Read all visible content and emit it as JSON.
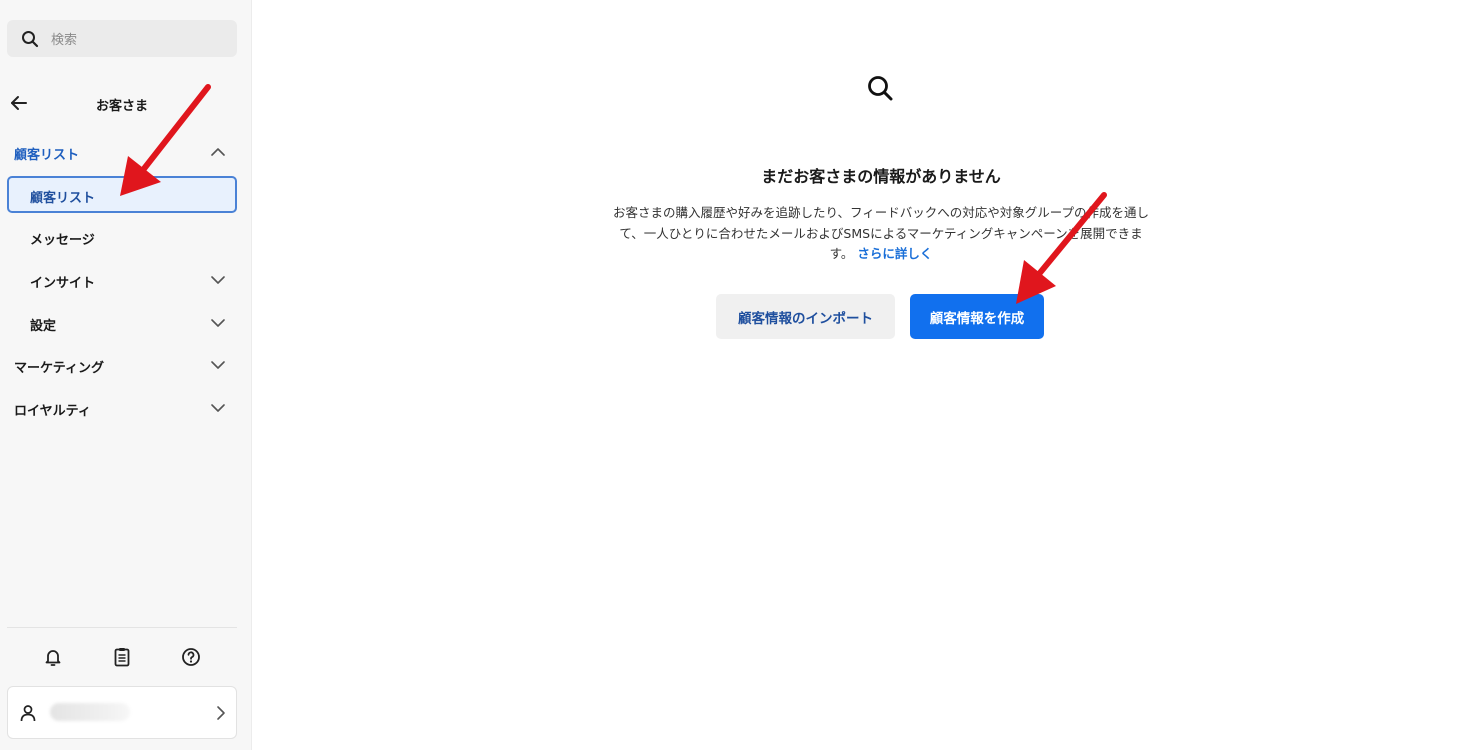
{
  "sidebar": {
    "search": {
      "placeholder": "検索",
      "icon": "search-icon"
    },
    "back": {
      "title": "お客さま",
      "icon": "arrow-left-icon"
    },
    "sections": [
      {
        "label": "顧客リスト",
        "expanded": true,
        "color": "#1f5fbf"
      },
      {
        "label": "マーケティング",
        "expanded": false
      },
      {
        "label": "ロイヤルティ",
        "expanded": false
      }
    ],
    "items": [
      {
        "label": "顧客リスト",
        "active": true
      },
      {
        "label": "メッセージ"
      },
      {
        "label": "インサイト",
        "expandable": true
      },
      {
        "label": "設定",
        "expandable": true
      }
    ],
    "footer_icons": [
      "bell-icon",
      "clipboard-icon",
      "help-icon"
    ],
    "account": {
      "icon": "user-icon"
    }
  },
  "main": {
    "icon": "search-icon",
    "empty_title": "まだお客さまの情報がありません",
    "empty_body_line1": "お客さまの購入履歴や好みを追跡したり、フィードバックへの対応や対象グループの作成を通し",
    "empty_body_line2": "て、一人ひとりに合わせたメールおよびSMSによるマーケティングキャンペーンを展開できま",
    "empty_body_line3": "す。",
    "learn_more": "さらに詳しく",
    "import_button": "顧客情報のインポート",
    "create_button": "顧客情報を作成"
  },
  "colors": {
    "accent": "#1170ee",
    "link": "#1a6fd8",
    "active_border": "#4a82d6",
    "active_bg": "#e8f1fd",
    "annotation_arrow": "#e0161d"
  }
}
